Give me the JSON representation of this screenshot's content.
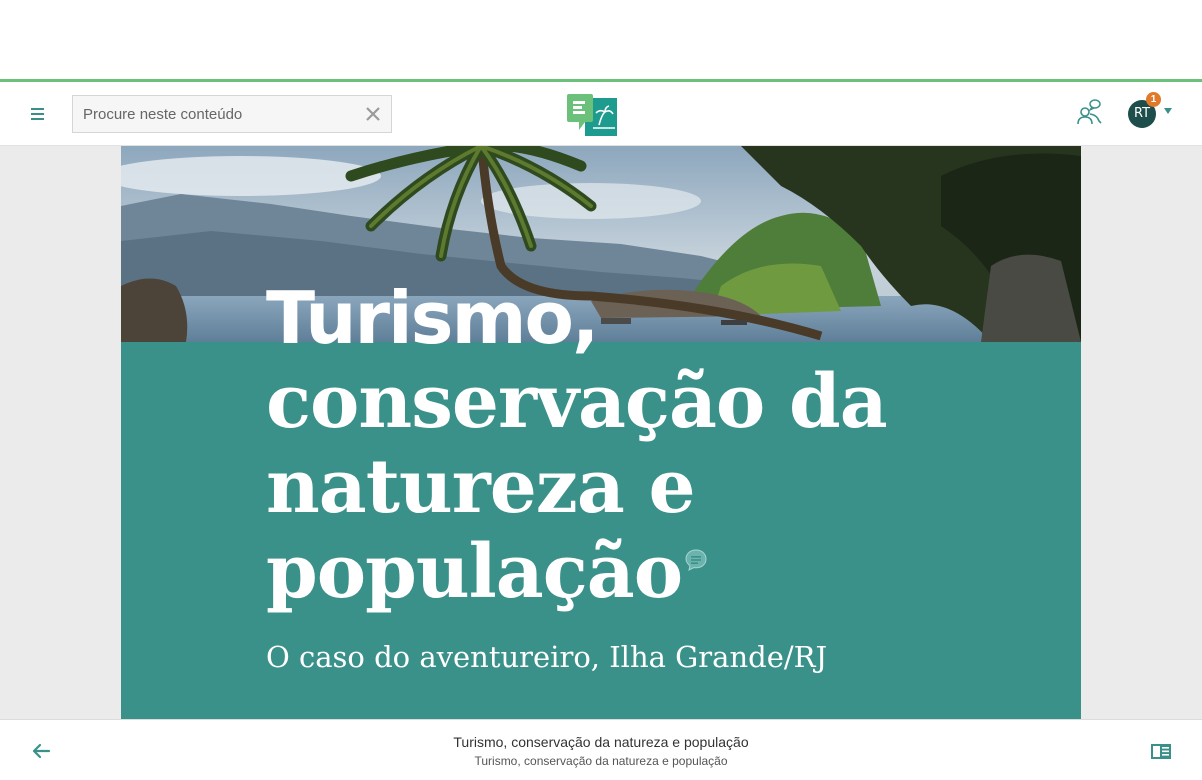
{
  "app": {
    "brand_color": "#3a918a",
    "accent_line_color": "#6cc17a"
  },
  "header": {
    "menu_icon": "hamburger-icon",
    "search": {
      "placeholder": "Procure neste conteúdo",
      "value": "",
      "clear_icon": "close-icon"
    },
    "logo_icon": "book-island-logo",
    "people_icon": "people-comment-icon",
    "user": {
      "initials": "RT",
      "notification_count": "1"
    }
  },
  "cover": {
    "title_bold": "Turismo,",
    "title_rest": "conservação da natureza e população",
    "subtitle": "O caso do aventureiro, Ilha Grande/RJ",
    "comment_icon": "comment-bubble-icon",
    "background_color": "#3a918a"
  },
  "footer": {
    "back_icon": "arrow-left-icon",
    "title": "Turismo, conservação da natureza e população",
    "subtitle": "Turismo, conservação da natureza e população",
    "toc_icon": "book-toc-icon"
  }
}
